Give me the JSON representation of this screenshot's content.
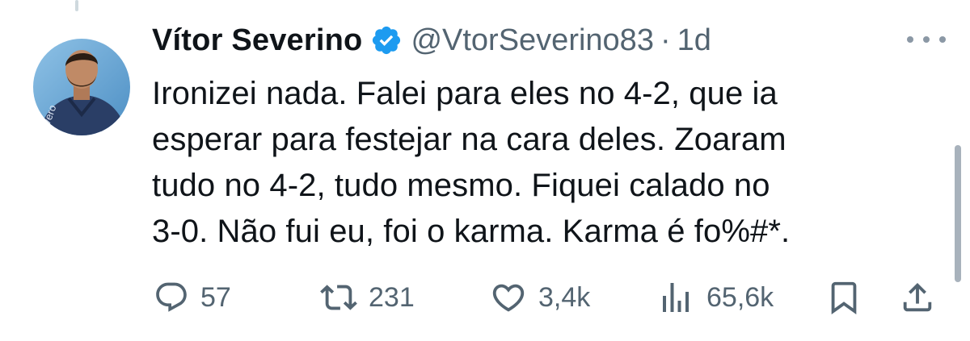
{
  "tweet": {
    "author": {
      "display_name": "Vítor Severino",
      "handle": "@VtorSeverino83",
      "verified": true,
      "avatar_icon": "profile-photo"
    },
    "separator": "·",
    "time": "1d",
    "text_lines": [
      "Ironizei nada. Falei para eles no 4-2, que ia",
      "esperar para festejar na cara deles. Zoaram",
      "tudo no 4-2, tudo mesmo. Fiquei calado no",
      "3-0. Não fui eu, foi o karma. Karma é fo%#*."
    ],
    "actions": {
      "replies": "57",
      "reposts": "231",
      "likes": "3,4k",
      "views": "65,6k"
    }
  },
  "icons": {
    "reply": "reply-icon",
    "repost": "repost-icon",
    "like": "heart-icon",
    "views": "views-icon",
    "bookmark": "bookmark-icon",
    "share": "share-icon",
    "more": "more-icon",
    "verified": "verified-badge-icon"
  },
  "colors": {
    "text": "#0f1419",
    "secondary": "#536471",
    "verified": "#1d9bf0"
  }
}
